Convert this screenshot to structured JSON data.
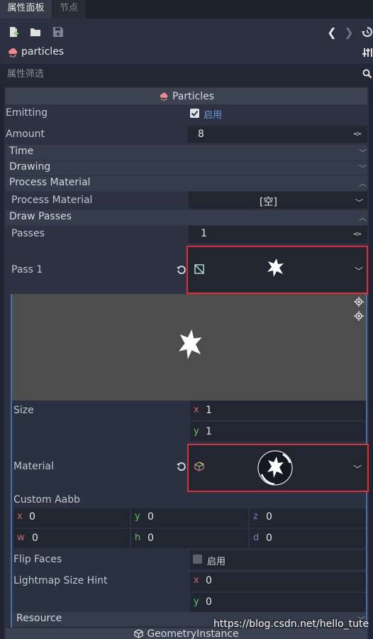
{
  "tabs": [
    {
      "label": "属性面板",
      "active": true
    },
    {
      "label": "节点",
      "active": false
    }
  ],
  "toolbar": {
    "new_icon": "new-resource-icon",
    "open_icon": "folder-open-icon",
    "save_icon": "save-icon",
    "history_back_icon": "chevron-left-icon",
    "history_forward_icon": "chevron-right-icon",
    "history_icon": "history-icon"
  },
  "node": {
    "name": "particles",
    "icon": "particles-cloud-icon",
    "tools_icon": "object-properties-icon"
  },
  "filter": {
    "placeholder": "属性筛选"
  },
  "particles": {
    "header": "Particles",
    "emitting": {
      "label": "Emitting",
      "checked": true,
      "value": "启用"
    },
    "amount": {
      "label": "Amount",
      "value": "8"
    },
    "groups": {
      "time": "Time",
      "drawing": "Drawing",
      "process_material": "Process Material",
      "draw_passes": "Draw Passes"
    },
    "process_material": {
      "label": "Process Material",
      "value": "[空]"
    },
    "passes": {
      "label": "Passes",
      "value": "1"
    },
    "pass1": {
      "label": "Pass 1"
    },
    "size": {
      "label": "Size",
      "x_tag": "x",
      "x": "1",
      "y_tag": "y",
      "y": "1"
    },
    "material": {
      "label": "Material"
    },
    "custom_aabb": {
      "label": "Custom Aabb",
      "x_tag": "x",
      "x": "0",
      "y_tag": "y",
      "y": "0",
      "z_tag": "z",
      "z": "0",
      "w_tag": "w",
      "w": "0",
      "h_tag": "h",
      "h": "0",
      "d_tag": "d",
      "d": "0"
    },
    "flip_faces": {
      "label": "Flip Faces",
      "checked": false,
      "value": "启用"
    },
    "lightmap_size_hint": {
      "label": "Lightmap Size Hint",
      "x_tag": "x",
      "x": "0",
      "y_tag": "y",
      "y": "0"
    },
    "resource": {
      "label": "Resource"
    }
  },
  "geometry_instance": {
    "header": "GeometryInstance"
  },
  "watermark": "https://blog.csdn.net/hello_tute",
  "colors": {
    "accent": "#6b9bdf",
    "highlight_box": "#e02e38",
    "particles_icon": "#f08a8a"
  }
}
